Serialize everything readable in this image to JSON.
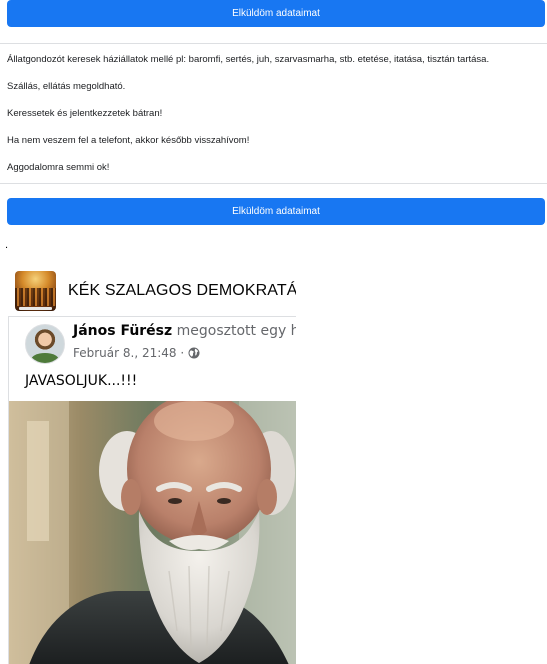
{
  "form": {
    "submit_label": "Elküldöm adataimat",
    "paragraphs": [
      "Állatgondozót keresek háziállatok mellé pl: baromfi, sertés, juh, szarvasmarha, stb. etetése, itatása, tisztán tartása.",
      "Szállás, ellátás megoldható.",
      "Keressetek és jelentkezzetek bátran!",
      "Ha nem veszem fel a telefont, akkor később visszahívom!",
      "Aggodalomra semmi ok!"
    ]
  },
  "separator_dot": ".",
  "post": {
    "group_name": "KÉK SZALAGOS DEMOKRATÁK",
    "author": "János Fürész",
    "shared_text": " megosztott egy hiva",
    "date": "Február 8., 21:48 ·",
    "text": "JAVASOLJUK...!!!",
    "icons": {
      "group_avatar": "group-avatar-image",
      "privacy": "globe-icon",
      "photo": "bearded-man-photo"
    }
  },
  "colors": {
    "button": "#1877f2",
    "button_text": "#ffffff",
    "secondary_text": "#65676b"
  }
}
